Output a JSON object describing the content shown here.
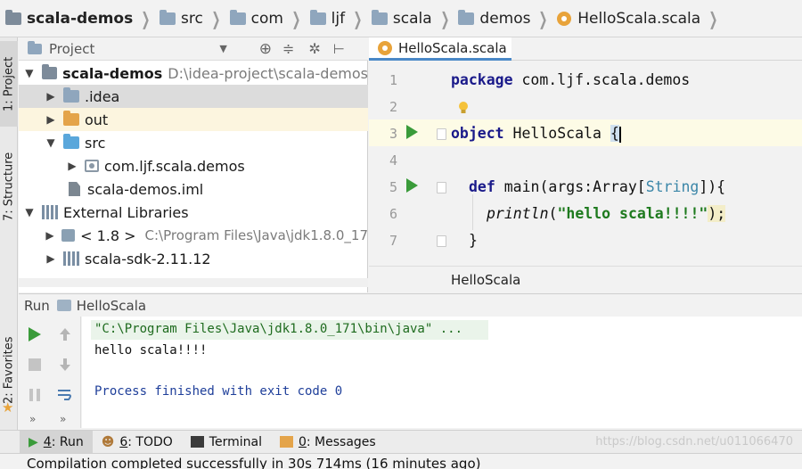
{
  "breadcrumb": {
    "items": [
      "scala-demos",
      "src",
      "com",
      "ljf",
      "scala",
      "demos",
      "HelloScala.scala"
    ]
  },
  "left_strip": {
    "tabs": [
      "1: Project",
      "7: Structure",
      "2: Favorites"
    ]
  },
  "project": {
    "header_label": "Project",
    "tree": [
      {
        "label": "scala-demos",
        "path": "D:\\idea-project\\scala-demos"
      },
      {
        "label": ".idea"
      },
      {
        "label": "out"
      },
      {
        "label": "src"
      },
      {
        "label": "com.ljf.scala.demos"
      },
      {
        "label": "scala-demos.iml"
      },
      {
        "label": "External Libraries"
      },
      {
        "label": "< 1.8 >",
        "path": "C:\\Program Files\\Java\\jdk1.8.0_17"
      },
      {
        "label": "scala-sdk-2.11.12"
      }
    ]
  },
  "editor": {
    "tab_label": "HelloScala.scala",
    "footer_label": "HelloScala",
    "line_numbers": [
      "1",
      "2",
      "3",
      "4",
      "5",
      "6",
      "7"
    ],
    "code": {
      "l1_kw": "package",
      "l1_rest": " com.ljf.scala.demos",
      "l3_kw": "object",
      "l3_rest": " HelloScala ",
      "l3_brace": "{",
      "l5_kw": "def",
      "l5_a": " main(args:Array[",
      "l5_type": "String",
      "l5_b": "]){",
      "l6_fn": "println",
      "l6_open": "(",
      "l6_str": "\"hello scala!!!!\"",
      "l6_close": ");",
      "l7": "}"
    }
  },
  "run": {
    "header_label": "Run",
    "config_label": "HelloScala",
    "output": [
      "\"C:\\Program Files\\Java\\jdk1.8.0_171\\bin\\java\" ...",
      "hello scala!!!!",
      "",
      "Process finished with exit code 0"
    ]
  },
  "bottom_bar": {
    "tabs": [
      {
        "key": "4",
        "rest": ": Run"
      },
      {
        "key": "6",
        "rest": ": TODO"
      },
      {
        "key": "",
        "rest": "Terminal"
      },
      {
        "key": "0",
        "rest": ": Messages"
      }
    ],
    "watermark": "https://blog.csdn.net/u011066470"
  },
  "status": {
    "text": "Compilation completed successfully in 30s 714ms (16 minutes ago)"
  },
  "colors": {
    "keyword": "#1a1a8a",
    "string": "#1e7a1e",
    "run_green": "#3a9b3a",
    "selection": "#dcdcdc"
  }
}
